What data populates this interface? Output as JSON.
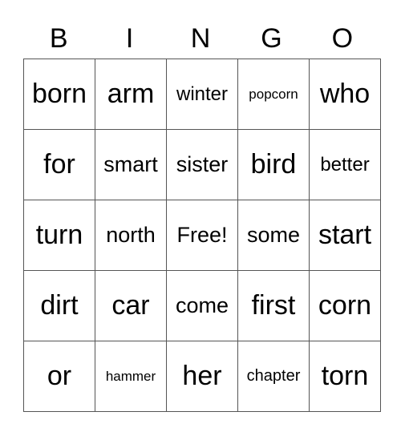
{
  "header": [
    "B",
    "I",
    "N",
    "G",
    "O"
  ],
  "rows": [
    [
      {
        "t": "born",
        "s": "s-xl"
      },
      {
        "t": "arm",
        "s": "s-xl"
      },
      {
        "t": "winter",
        "s": "s-s"
      },
      {
        "t": "popcorn",
        "s": "s-xxs"
      },
      {
        "t": "who",
        "s": "s-xl"
      }
    ],
    [
      {
        "t": "for",
        "s": "s-xl"
      },
      {
        "t": "smart",
        "s": "s-m"
      },
      {
        "t": "sister",
        "s": "s-m"
      },
      {
        "t": "bird",
        "s": "s-xl"
      },
      {
        "t": "better",
        "s": "s-s"
      }
    ],
    [
      {
        "t": "turn",
        "s": "s-xl"
      },
      {
        "t": "north",
        "s": "s-m"
      },
      {
        "t": "Free!",
        "s": "s-m"
      },
      {
        "t": "some",
        "s": "s-m"
      },
      {
        "t": "start",
        "s": "s-xl"
      }
    ],
    [
      {
        "t": "dirt",
        "s": "s-xl"
      },
      {
        "t": "car",
        "s": "s-xl"
      },
      {
        "t": "come",
        "s": "s-m"
      },
      {
        "t": "first",
        "s": "s-xl"
      },
      {
        "t": "corn",
        "s": "s-xl"
      }
    ],
    [
      {
        "t": "or",
        "s": "s-xl"
      },
      {
        "t": "hammer",
        "s": "s-xxs"
      },
      {
        "t": "her",
        "s": "s-xl"
      },
      {
        "t": "chapter",
        "s": "s-xs"
      },
      {
        "t": "torn",
        "s": "s-xl"
      }
    ]
  ]
}
